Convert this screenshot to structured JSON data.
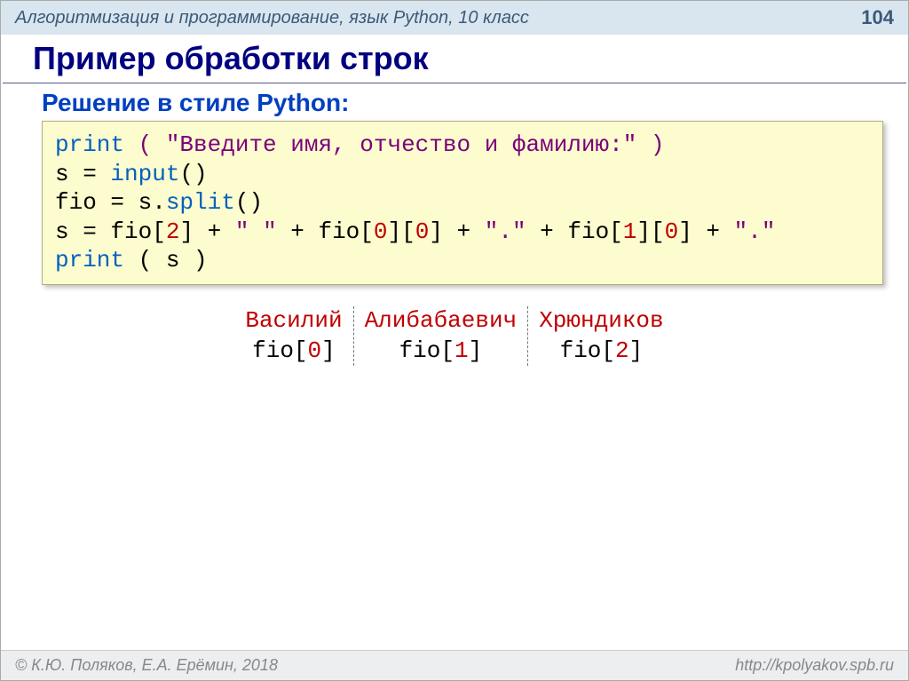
{
  "header": {
    "breadcrumb": "Алгоритмизация и программирование, язык Python, 10 класс",
    "page": "104"
  },
  "title": "Пример обработки строк",
  "subtitle": "Решение в стиле Python:",
  "code": {
    "l1_kw": "print",
    "l1_str": "( \"Введите имя, отчество и фамилию:\" )",
    "l2a": "s = ",
    "l2_kw": "input",
    "l2b": "()",
    "l3a": "fio = s.",
    "l3_kw": "split",
    "l3b": "()",
    "l4_p1": "s = fio[",
    "l4_n1": "2",
    "l4_p2": "] + ",
    "l4_s1": "\" \"",
    "l4_p3": " + fio[",
    "l4_n2": "0",
    "l4_p4": "][",
    "l4_n3": "0",
    "l4_p5": "] + ",
    "l4_s2": "\".\"",
    "l4_p6": " + fio[",
    "l4_n4": "1",
    "l4_p7": "][",
    "l4_n5": "0",
    "l4_p8": "] + ",
    "l4_s3": "\".\"",
    "l5_kw": "print",
    "l5_rest": " ( s )"
  },
  "example": {
    "words": [
      "Василий",
      "Алибабаевич",
      "Хрюндиков"
    ],
    "labels": [
      {
        "pre": "fio[",
        "idx": "0",
        "post": "]"
      },
      {
        "pre": "fio[",
        "idx": "1",
        "post": "]"
      },
      {
        "pre": "fio[",
        "idx": "2",
        "post": "]"
      }
    ]
  },
  "footer": {
    "left": "© К.Ю. Поляков, Е.А. Ерёмин, 2018",
    "right": "http://kpolyakov.spb.ru"
  }
}
